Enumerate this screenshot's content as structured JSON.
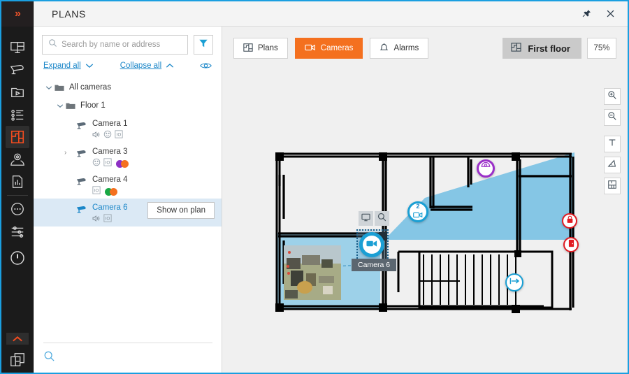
{
  "window": {
    "title": "PLANS",
    "pin_icon": "pin-icon",
    "close_icon": "close-icon"
  },
  "rail": {
    "expand_icon": "double-chevron-right-icon",
    "items": [
      {
        "icon": "monitor-grid-icon",
        "name": "video-wall",
        "active": false
      },
      {
        "icon": "cctv-camera-icon",
        "name": "cameras",
        "active": false
      },
      {
        "icon": "folder-play-icon",
        "name": "archive",
        "active": false
      },
      {
        "icon": "list-icon",
        "name": "events",
        "active": false
      },
      {
        "icon": "floorplan-icon",
        "name": "plans",
        "active": true
      },
      {
        "icon": "map-pin-icon",
        "name": "maps",
        "active": false
      },
      {
        "icon": "report-doc-icon",
        "name": "reports",
        "active": false
      },
      {
        "icon": "dots-circle-icon",
        "name": "more",
        "active": false
      },
      {
        "icon": "sliders-icon",
        "name": "settings",
        "active": false
      },
      {
        "icon": "power-icon",
        "name": "power",
        "active": false
      }
    ],
    "caret_icon": "chevron-up-icon",
    "layout_icon": "layouts-icon"
  },
  "sidebar": {
    "search": {
      "placeholder": "Search by name or address",
      "value": "",
      "icon": "search-icon"
    },
    "filter_button": {
      "name": "filter-button",
      "icon": "funnel-icon"
    },
    "expand_all": "Expand all",
    "collapse_all": "Collapse all",
    "visibility_icon": "eye-icon",
    "tree": {
      "root": {
        "label": "All cameras",
        "icon": "folder-icon",
        "expanded": true
      },
      "group": {
        "label": "Floor 1",
        "icon": "folder-icon",
        "expanded": true
      },
      "cameras": [
        {
          "name": "Camera 1",
          "icon": "cctv-camera-icon",
          "has_chevron": false,
          "selected": false,
          "badges": [
            "audio-icon",
            "ptz-icon",
            "io-icon"
          ],
          "dots": []
        },
        {
          "name": "Camera 3",
          "icon": "cctv-camera-icon",
          "has_chevron": true,
          "selected": false,
          "badges": [
            "ptz-icon",
            "io-icon"
          ],
          "dots": [
            "#8d2fc4",
            "#f4701f"
          ]
        },
        {
          "name": "Camera 4",
          "icon": "cctv-camera-icon",
          "has_chevron": false,
          "selected": false,
          "badges": [
            "io-icon"
          ],
          "dots": [
            "#18a845",
            "#f4701f"
          ]
        },
        {
          "name": "Camera 6",
          "icon": "cctv-camera-icon",
          "has_chevron": false,
          "selected": true,
          "badges": [
            "audio-icon",
            "io-icon"
          ],
          "dots": []
        }
      ]
    },
    "context_button": "Show on plan",
    "bottom_search_icon": "search-icon"
  },
  "main": {
    "tabs": [
      {
        "label": "Plans",
        "icon": "floorplan-icon",
        "active": false
      },
      {
        "label": "Cameras",
        "icon": "video-camera-icon",
        "active": true
      },
      {
        "label": "Alarms",
        "icon": "bell-icon",
        "active": false
      }
    ],
    "floor_selector": {
      "label": "First floor",
      "icon": "floorplan-icon"
    },
    "zoom_level": "75%",
    "vertical_tools": [
      {
        "name": "zoom-in-button",
        "icon": "magnifier-plus-icon"
      },
      {
        "name": "zoom-out-button",
        "icon": "magnifier-minus-icon"
      },
      {
        "name": "text-tool-button",
        "icon": "text-t-icon"
      },
      {
        "name": "angle-tool-button",
        "icon": "angle-ruler-icon"
      },
      {
        "name": "layout-tool-button",
        "icon": "plan-grid-icon"
      }
    ]
  },
  "plan": {
    "markers": [
      {
        "name": "camera-cluster-marker",
        "type": "cluster",
        "count": "2",
        "icon": "video-camera-icon",
        "color": "#1a9fd4"
      },
      {
        "name": "dome-camera-marker",
        "type": "dome",
        "icon": "dome-camera-icon",
        "color": "#9b30c9"
      },
      {
        "name": "lock-device-marker",
        "type": "alarm",
        "icon": "lock-icon",
        "color": "#e11b22"
      },
      {
        "name": "door-device-marker",
        "type": "alarm",
        "icon": "door-icon",
        "color": "#e11b22"
      },
      {
        "name": "exit-direction-marker",
        "type": "blue",
        "icon": "exit-arrow-icon",
        "color": "#1a9fd4"
      },
      {
        "name": "selected-camera-marker",
        "type": "selected",
        "icon": "video-camera-icon",
        "color": "#1a9fd4"
      }
    ],
    "selected_camera_tooltip": "Camera 6",
    "marker_tools": [
      {
        "name": "show-live-view-button",
        "icon": "monitor-icon"
      },
      {
        "name": "search-archive-button",
        "icon": "magnifier-icon"
      }
    ],
    "fov_color": "#8ecbe8"
  },
  "colors": {
    "accent_orange": "#f4701f",
    "accent_blue": "#1a9fd4",
    "link_blue": "#1a86c8",
    "purple": "#9b30c9",
    "red": "#e11b22",
    "green": "#18a845",
    "rail_dark": "#1b1b1b",
    "canvas_bg": "#f0f0f0"
  }
}
